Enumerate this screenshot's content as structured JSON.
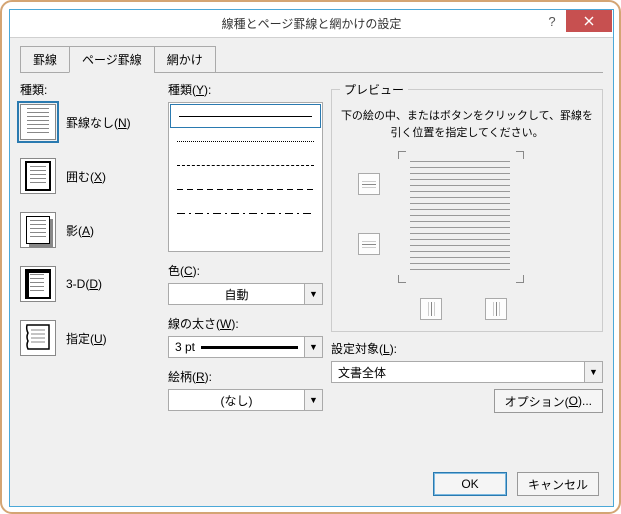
{
  "titlebar": {
    "title": "線種とページ罫線と網かけの設定"
  },
  "tabs": {
    "t0": "罫線",
    "t1": "ページ罫線",
    "t2": "網かけ"
  },
  "col1": {
    "label": "種類:",
    "items": {
      "none": "罫線なし(N)",
      "box": "囲む(X)",
      "shadow": "影(A)",
      "threeD": "3-D(D)",
      "custom": "指定(U)"
    }
  },
  "col2": {
    "style_label": "種類(Y):",
    "color_label": "色(C):",
    "color_value": "自動",
    "width_label": "線の太さ(W):",
    "width_value": "3 pt",
    "art_label": "絵柄(R):",
    "art_value": "(なし)"
  },
  "preview": {
    "legend": "プレビュー",
    "hint": "下の絵の中、またはボタンをクリックして、罫線を引く位置を指定してください。",
    "apply_label": "設定対象(L):",
    "apply_value": "文書全体",
    "options": "オプション(O)..."
  },
  "footer": {
    "ok": "OK",
    "cancel": "キャンセル"
  }
}
